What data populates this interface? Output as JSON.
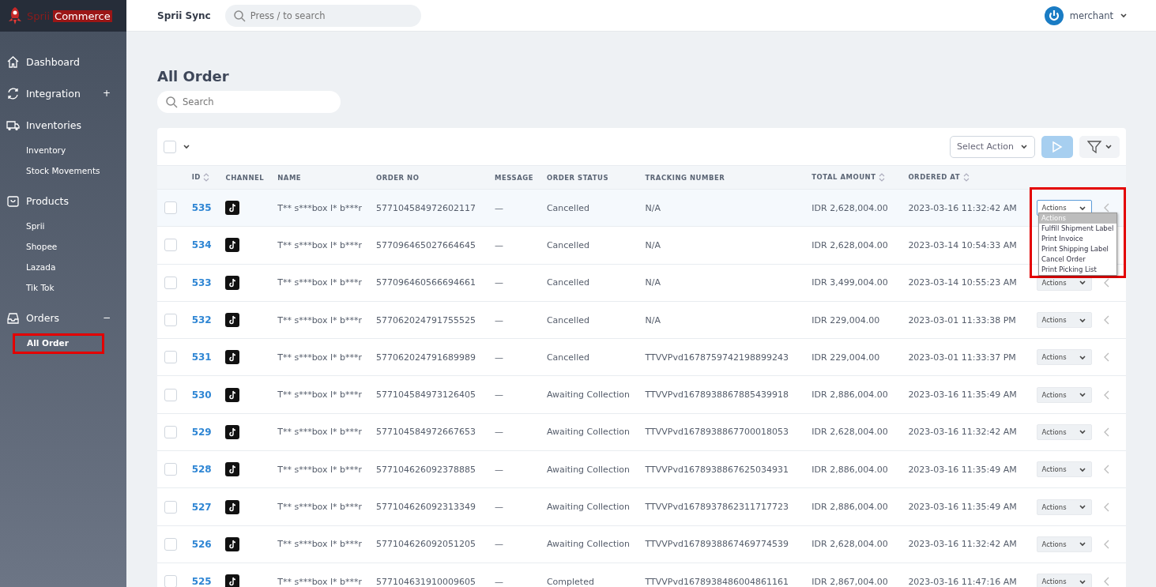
{
  "logo": {
    "part1": "Sprii",
    "part2": "Commerce"
  },
  "topbar": {
    "title": "Sprii Sync",
    "search_placeholder": "Press / to search",
    "user": "merchant"
  },
  "sidebar": {
    "items": [
      {
        "label": "Dashboard"
      },
      {
        "label": "Integration",
        "toggle": "+"
      },
      {
        "label": "Inventories",
        "children": [
          {
            "label": "Inventory",
            "selected": false,
            "highlighted": false
          },
          {
            "label": "Stock Movements",
            "selected": false,
            "highlighted": false
          }
        ]
      },
      {
        "label": "Products",
        "children": [
          {
            "label": "Sprii",
            "selected": false,
            "highlighted": false
          },
          {
            "label": "Shopee",
            "selected": false,
            "highlighted": false
          },
          {
            "label": "Lazada",
            "selected": false,
            "highlighted": false
          },
          {
            "label": "Tik Tok",
            "selected": false,
            "highlighted": false
          }
        ]
      },
      {
        "label": "Orders",
        "toggle": "−",
        "children": [
          {
            "label": "All Order",
            "selected": true,
            "highlighted": true
          }
        ]
      }
    ]
  },
  "page": {
    "title": "All Order",
    "search_placeholder": "Search"
  },
  "toolbar": {
    "select_all_checked": false,
    "select_action": "Select Action"
  },
  "table": {
    "columns": [
      {
        "label": "ID",
        "sortable": true
      },
      {
        "label": "CHANNEL",
        "sortable": false
      },
      {
        "label": "NAME",
        "sortable": false
      },
      {
        "label": "ORDER NO",
        "sortable": false
      },
      {
        "label": "MESSAGE",
        "sortable": false
      },
      {
        "label": "ORDER STATUS",
        "sortable": false
      },
      {
        "label": "TRACKING NUMBER",
        "sortable": false
      },
      {
        "label": "TOTAL AMOUNT",
        "sortable": true
      },
      {
        "label": "ORDERED AT",
        "sortable": true
      }
    ],
    "rows": [
      {
        "checked": false,
        "id": "535",
        "name": "T** s***box l* b***r",
        "order_no": "577104584972602117",
        "message": "—",
        "status": "Cancelled",
        "tracking": "N/A",
        "total": "IDR 2,628,004.00",
        "ordered_at": "2023-03-16 11:32:42 AM",
        "action": "Actions",
        "hovered": true,
        "menu_open": true
      },
      {
        "checked": false,
        "id": "534",
        "name": "T** s***box l* b***r",
        "order_no": "577096465027664645",
        "message": "—",
        "status": "Cancelled",
        "tracking": "N/A",
        "total": "IDR 2,628,004.00",
        "ordered_at": "2023-03-14 10:54:33 AM",
        "hovered": false,
        "menu_open": false
      },
      {
        "checked": false,
        "id": "533",
        "name": "T** s***box l* b***r",
        "order_no": "577096460566694661",
        "message": "—",
        "status": "Cancelled",
        "tracking": "N/A",
        "total": "IDR 3,499,004.00",
        "ordered_at": "2023-03-14 10:55:23 AM",
        "action": "Actions",
        "hovered": false,
        "menu_open": false
      },
      {
        "checked": false,
        "id": "532",
        "name": "T** s***box l* b***r",
        "order_no": "577062024791755525",
        "message": "—",
        "status": "Cancelled",
        "tracking": "N/A",
        "total": "IDR 229,004.00",
        "ordered_at": "2023-03-01 11:33:38 PM",
        "action": "Actions",
        "hovered": false,
        "menu_open": false
      },
      {
        "checked": false,
        "id": "531",
        "name": "T** s***box l* b***r",
        "order_no": "577062024791689989",
        "message": "—",
        "status": "Cancelled",
        "tracking": "TTVVPvd1678759742198899243",
        "total": "IDR 229,004.00",
        "ordered_at": "2023-03-01 11:33:37 PM",
        "action": "Actions",
        "hovered": false,
        "menu_open": false
      },
      {
        "checked": false,
        "id": "530",
        "name": "T** s***box l* b***r",
        "order_no": "577104584973126405",
        "message": "—",
        "status": "Awaiting Collection",
        "tracking": "TTVVPvd1678938867885439918",
        "total": "IDR 2,886,004.00",
        "ordered_at": "2023-03-16 11:35:49 AM",
        "action": "Actions",
        "hovered": false,
        "menu_open": false
      },
      {
        "checked": false,
        "id": "529",
        "name": "T** s***box l* b***r",
        "order_no": "577104584972667653",
        "message": "—",
        "status": "Awaiting Collection",
        "tracking": "TTVVPvd1678938867700018053",
        "total": "IDR 2,628,004.00",
        "ordered_at": "2023-03-16 11:32:42 AM",
        "action": "Actions",
        "hovered": false,
        "menu_open": false
      },
      {
        "checked": false,
        "id": "528",
        "name": "T** s***box l* b***r",
        "order_no": "577104626092378885",
        "message": "—",
        "status": "Awaiting Collection",
        "tracking": "TTVVPvd1678938867625034931",
        "total": "IDR 2,886,004.00",
        "ordered_at": "2023-03-16 11:35:49 AM",
        "action": "Actions",
        "hovered": false,
        "menu_open": false
      },
      {
        "checked": false,
        "id": "527",
        "name": "T** s***box l* b***r",
        "order_no": "577104626092313349",
        "message": "—",
        "status": "Awaiting Collection",
        "tracking": "TTVVPvd1678937862311717723",
        "total": "IDR 2,886,004.00",
        "ordered_at": "2023-03-16 11:35:49 AM",
        "action": "Actions",
        "hovered": false,
        "menu_open": false
      },
      {
        "checked": false,
        "id": "526",
        "name": "T** s***box l* b***r",
        "order_no": "577104626092051205",
        "message": "—",
        "status": "Awaiting Collection",
        "tracking": "TTVVPvd1678938867469774539",
        "total": "IDR 2,628,004.00",
        "ordered_at": "2023-03-16 11:32:42 AM",
        "action": "Actions",
        "hovered": false,
        "menu_open": false
      },
      {
        "checked": false,
        "id": "525",
        "name": "T** s***box l* b***r",
        "order_no": "577104631910009605",
        "message": "—",
        "status": "Completed",
        "tracking": "TTVVPvd1678938486004861161",
        "total": "IDR 2,867,004.00",
        "ordered_at": "2023-03-16 11:47:16 AM",
        "action": "Actions",
        "hovered": false,
        "menu_open": false
      }
    ]
  },
  "action_menu": {
    "highlighted": true,
    "options": [
      {
        "label": "Actions",
        "selected": true
      },
      {
        "label": "Fulfill Shipment Label",
        "selected": false
      },
      {
        "label": "Print Invoice",
        "selected": false
      },
      {
        "label": "Print Shipping Label",
        "selected": false
      },
      {
        "label": "Cancel Order",
        "selected": false
      },
      {
        "label": "Print Picking List",
        "selected": false
      }
    ]
  }
}
